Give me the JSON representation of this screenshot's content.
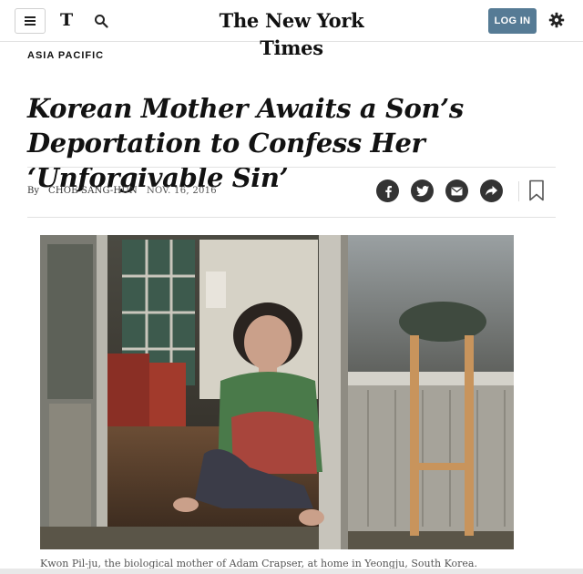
{
  "header": {
    "brand": "The New York Times",
    "t_logo": "T",
    "login_label": "LOG IN",
    "icons": [
      "menu-icon",
      "nyt-t-icon",
      "search-icon",
      "gear-icon"
    ],
    "login_color": "#567b95"
  },
  "article": {
    "section": "ASIA PACIFIC",
    "headline": "Korean Mother Awaits a Son’s Deportation to Confess Her ‘Unforgivable Sin’",
    "byline_prefix": "By",
    "author": "CHOE SANG-HUN",
    "date": "NOV. 16, 2016",
    "share_icons": [
      "facebook-icon",
      "twitter-icon",
      "email-icon",
      "share-arrow-icon",
      "bookmark-icon"
    ],
    "photo_caption": "Kwon Pil-ju, the biological mother of Adam Crapser, at home in Yeongju, South Korea."
  }
}
